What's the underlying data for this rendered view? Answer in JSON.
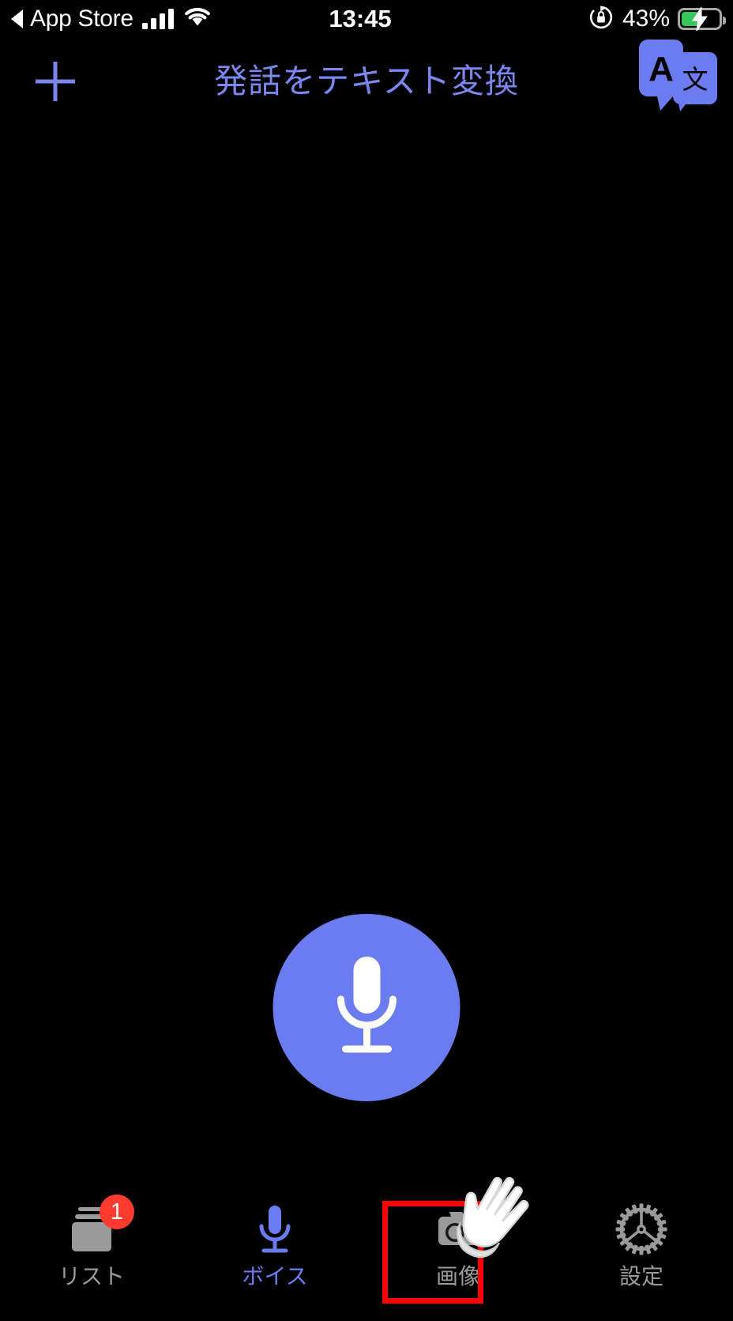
{
  "status_bar": {
    "back_label": "App Store",
    "back_icon": "triangle-left-icon",
    "signal_icon": "cellular-signal-icon",
    "signal_bars": 4,
    "wifi_icon": "wifi-icon",
    "time": "13:45",
    "rotation_lock_icon": "rotation-lock-icon",
    "battery_percent_label": "43%",
    "battery_level": 43,
    "battery_charging": true,
    "battery_icon": "battery-charging-icon",
    "colors": {
      "text": "#ffffff",
      "battery_fill": "#35c759"
    }
  },
  "nav_bar": {
    "add_button_label": "+",
    "add_button_icon": "plus-icon",
    "title": "発話をテキスト変換",
    "translate_button_icon": "translate-icon",
    "translate_button_letters": {
      "source": "A",
      "target": "文"
    },
    "accent_color": "#7b86ef"
  },
  "main": {
    "record_button_icon": "microphone-icon",
    "record_button_color": "#6b7cf0"
  },
  "tab_bar": {
    "tabs": [
      {
        "id": "list",
        "label": "リスト",
        "icon": "stacked-cards-icon",
        "active": false,
        "badge": "1"
      },
      {
        "id": "voice",
        "label": "ボイス",
        "icon": "microphone-icon",
        "active": true,
        "badge": null
      },
      {
        "id": "image",
        "label": "画像",
        "icon": "camera-icon",
        "active": false,
        "badge": null
      },
      {
        "id": "settings",
        "label": "設定",
        "icon": "gear-icon",
        "active": false,
        "badge": null
      }
    ],
    "active_color": "#6b7cf0",
    "inactive_color": "#9a9a9a"
  },
  "annotations": {
    "highlight_target": "画像",
    "highlight_color": "#ff0000",
    "cursor_icon": "hand-pointer-icon"
  }
}
